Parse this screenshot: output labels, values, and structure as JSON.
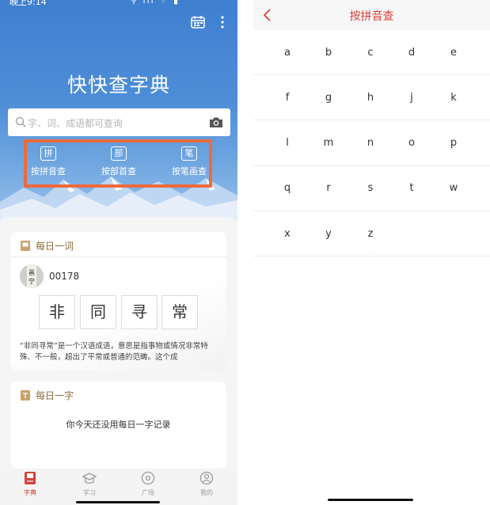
{
  "status": {
    "time": "晚上9:14",
    "icons": "⚲ ıll ⌔ ▮"
  },
  "left": {
    "app_title": "快快查字典",
    "search": {
      "placeholder": "字、词、成语都可查询"
    },
    "modes": [
      {
        "glyph": "拼",
        "label": "按拼音查"
      },
      {
        "glyph": "部",
        "label": "按部首查"
      },
      {
        "glyph": "笔",
        "label": "按笔画查"
      }
    ],
    "daily_word": {
      "title": "每日一词",
      "avatar_text": "邕宁",
      "number": "00178",
      "chars": [
        "非",
        "同",
        "寻",
        "常"
      ],
      "description": "“非同寻常”是一个汉语成语，意思是指事物或情况非常特殊、不一般，超出了平常或普通的范畴。这个成"
    },
    "daily_char": {
      "title": "每日一字",
      "empty_text": "你今天还没用每日一字记录"
    },
    "tabs": [
      {
        "label": "字典",
        "icon": "book-icon",
        "active": true
      },
      {
        "label": "学习",
        "icon": "graduation-cap-icon",
        "active": false
      },
      {
        "label": "广场",
        "icon": "compass-icon",
        "active": false
      },
      {
        "label": "我的",
        "icon": "user-icon",
        "active": false
      }
    ]
  },
  "right": {
    "title": "按拼音查",
    "letters": [
      [
        "a",
        "b",
        "c",
        "d",
        "e"
      ],
      [
        "f",
        "g",
        "h",
        "j",
        "k"
      ],
      [
        "l",
        "m",
        "n",
        "o",
        "p"
      ],
      [
        "q",
        "r",
        "s",
        "t",
        "w"
      ],
      [
        "x",
        "y",
        "z"
      ]
    ],
    "dot": "·"
  },
  "colors": {
    "accent": "#d8413a",
    "highlight": "#ee6a3a",
    "hero_blue": "#4e8ed8",
    "card_title": "#8a6a3a"
  }
}
